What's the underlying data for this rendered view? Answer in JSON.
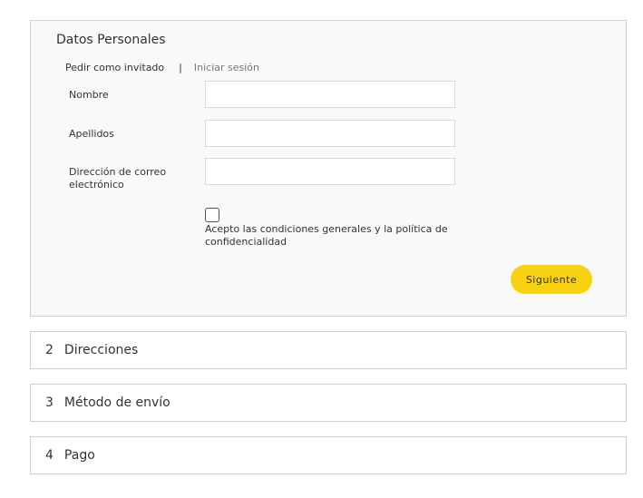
{
  "personal": {
    "title": "Datos Personales",
    "tab_guest": "Pedir como invitado",
    "tab_separator": "|",
    "tab_login": "Iniciar sesión",
    "fields": {
      "first_name": {
        "label": "Nombre",
        "value": "",
        "placeholder": ""
      },
      "last_name": {
        "label": "Apellidos",
        "value": "",
        "placeholder": ""
      },
      "email": {
        "label_line1": "Dirección de correo",
        "label_line2": "electrónico",
        "value": "",
        "placeholder": ""
      }
    },
    "consent_text": "Acepto las condiciones generales y la política de confidencialidad",
    "consent_checked": false,
    "next_button": "Siguiente",
    "accent_color": "#f8d210"
  },
  "steps": [
    {
      "number": "2",
      "label": "Direcciones"
    },
    {
      "number": "3",
      "label": "Método de envío"
    },
    {
      "number": "4",
      "label": "Pago"
    }
  ]
}
